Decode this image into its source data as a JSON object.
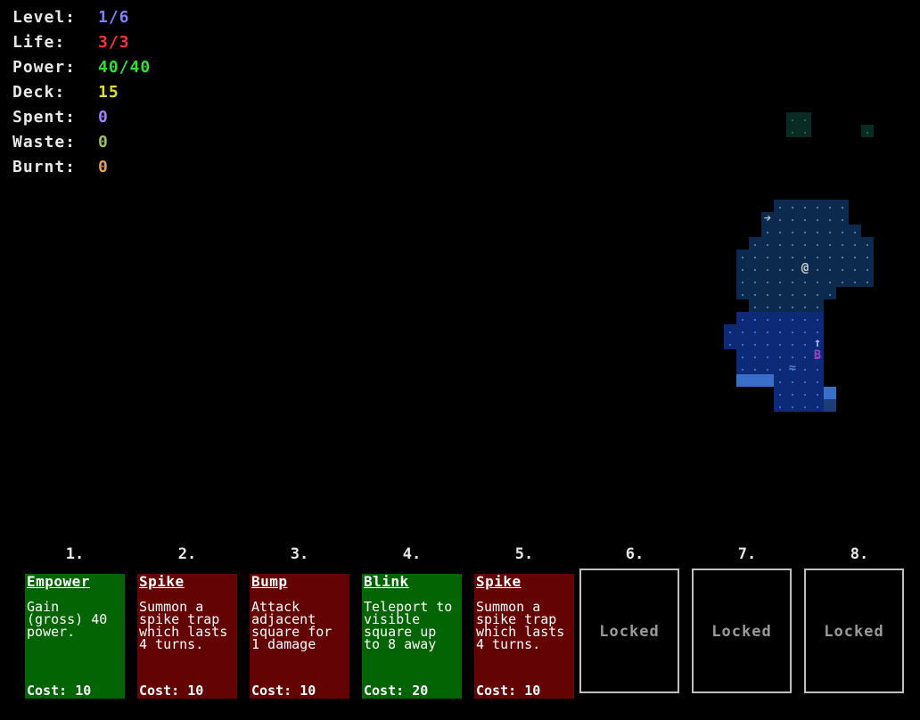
{
  "stats": [
    {
      "label": "Level:",
      "value": "1/6",
      "color": "#8080ff"
    },
    {
      "label": "Life:",
      "value": "3/3",
      "color": "#ff3030"
    },
    {
      "label": "Power:",
      "value": "40/40",
      "color": "#30e030"
    },
    {
      "label": "Deck:",
      "value": "15",
      "color": "#e0e030"
    },
    {
      "label": "Spent:",
      "value": "0",
      "color": "#a080ff"
    },
    {
      "label": "Waste:",
      "value": "0",
      "color": "#a0c060"
    },
    {
      "label": "Burnt:",
      "value": "0",
      "color": "#e0a060"
    }
  ],
  "map": {
    "player_glyph": "@",
    "enemy_glyph": "B",
    "exit_glyph": "➔",
    "arrow_glyph": "↑",
    "water_glyph": "≈",
    "colors": {
      "enemy": "#a040c0",
      "player": "#d0d0d0",
      "water": "#5080d0"
    }
  },
  "hand": {
    "slots": [
      {
        "number": "1.",
        "title": "Empower",
        "description": "Gain (gross) 40 power.",
        "cost_label": "Cost:",
        "cost": "10",
        "color": "green"
      },
      {
        "number": "2.",
        "title": "Spike",
        "description": "Summon a spike trap which lasts 4 turns.",
        "cost_label": "Cost:",
        "cost": "10",
        "color": "red"
      },
      {
        "number": "3.",
        "title": "Bump",
        "description": "Attack adjacent square for 1 damage",
        "cost_label": "Cost:",
        "cost": "10",
        "color": "red"
      },
      {
        "number": "4.",
        "title": "Blink",
        "description": "Teleport to visible square up to 8 away",
        "cost_label": "Cost:",
        "cost": "20",
        "color": "green"
      },
      {
        "number": "5.",
        "title": "Spike",
        "description": "Summon a spike trap which lasts 4 turns.",
        "cost_label": "Cost:",
        "cost": "10",
        "color": "red"
      }
    ],
    "locked": [
      {
        "number": "6.",
        "label": "Locked"
      },
      {
        "number": "7.",
        "label": "Locked"
      },
      {
        "number": "8.",
        "label": "Locked"
      }
    ]
  }
}
